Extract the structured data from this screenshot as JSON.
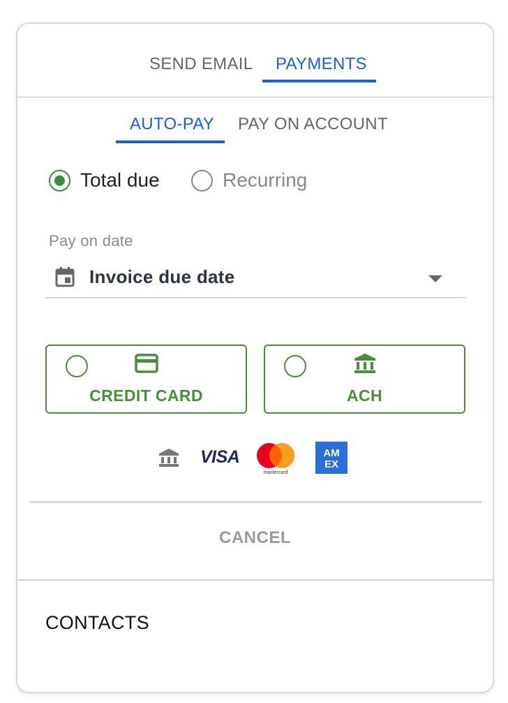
{
  "tabs": {
    "send_email": "SEND EMAIL",
    "payments": "PAYMENTS",
    "active": "PAYMENTS"
  },
  "sub_tabs": {
    "auto_pay": "AUTO-PAY",
    "pay_on_account": "PAY ON ACCOUNT",
    "active": "AUTO-PAY"
  },
  "amount_options": {
    "total_due": "Total due",
    "recurring": "Recurring",
    "selected": "Total due"
  },
  "pay_on_date": {
    "label": "Pay on date",
    "value": "Invoice due date",
    "icon": "calendar-icon"
  },
  "payment_methods": [
    {
      "label": "CREDIT CARD",
      "icon": "credit-card-icon",
      "selected": false
    },
    {
      "label": "ACH",
      "icon": "bank-icon",
      "selected": false
    }
  ],
  "accepted_logos": {
    "visa": "VISA",
    "mastercard": "mastercard",
    "amex": "AM EX"
  },
  "cancel_label": "CANCEL",
  "contacts_heading": "CONTACTS",
  "colors": {
    "active_tab": "#1a5fe0",
    "accent_green": "#4a8d3a",
    "radio_green": "#3a8f3a"
  }
}
